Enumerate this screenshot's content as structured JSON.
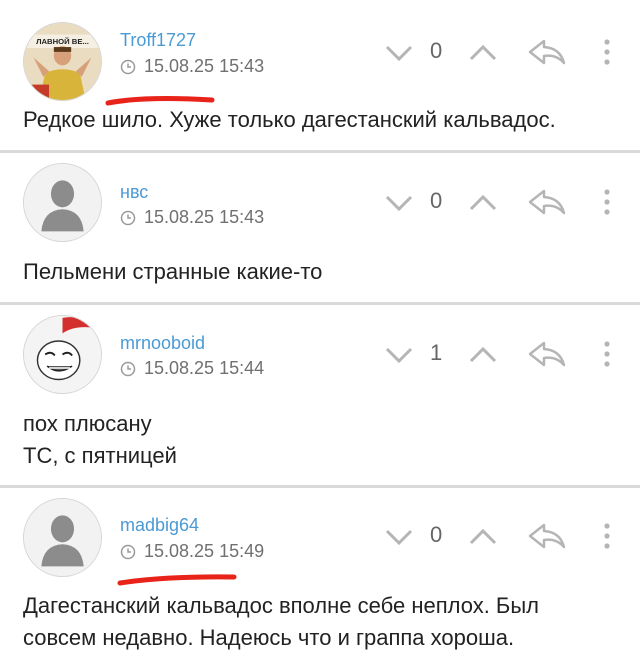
{
  "comments": [
    {
      "username": "Troff1727",
      "timestamp": "15.08.25 15:43",
      "score": "0",
      "lines": [
        "Редкое шило. Хуже только дагестанский кальвадос."
      ],
      "avatar_caption": "ЛАВНОЙ ВЕ..."
    },
    {
      "username": "нвс",
      "timestamp": "15.08.25 15:43",
      "score": "0",
      "lines": [
        "Пельмени странные какие-то"
      ]
    },
    {
      "username": "mrnooboid",
      "timestamp": "15.08.25 15:44",
      "score": "1",
      "lines": [
        "пох плюсану",
        "ТС, с пятницей"
      ]
    },
    {
      "username": "madbig64",
      "timestamp": "15.08.25 15:49",
      "score": "0",
      "lines": [
        "Дагестанский кальвадос вполне себе неплох. Был",
        "совсем недавно. Надеюсь что и граппа хороша."
      ]
    }
  ],
  "colors": {
    "username": "#4a9ad4",
    "meta": "#707070",
    "icon": "#b5b5b5",
    "annotation": "#e8231a",
    "divider": "#d9d9d9"
  },
  "icons": {
    "vote_down": "chevron-down-icon",
    "vote_up": "chevron-up-icon",
    "reply": "reply-arrow-icon",
    "more": "more-vertical-icon",
    "time": "clock-icon"
  }
}
